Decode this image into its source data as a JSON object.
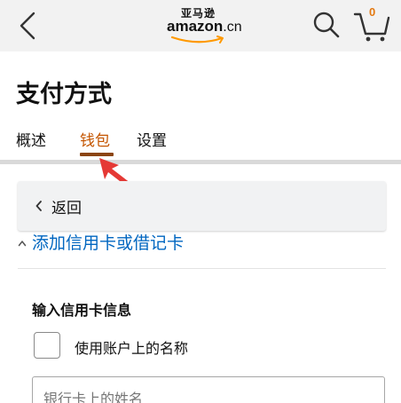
{
  "header": {
    "logo_cn": "亚马逊",
    "logo_main": "amazon",
    "logo_suffix": ".cn",
    "cart_count": "0"
  },
  "page": {
    "title": "支付方式"
  },
  "tabs": [
    {
      "label": "概述",
      "active": false
    },
    {
      "label": "钱包",
      "active": true
    },
    {
      "label": "设置",
      "active": false
    }
  ],
  "back_bar": {
    "label": "返回"
  },
  "add_card": {
    "label": "添加信用卡或借记卡"
  },
  "card_form": {
    "heading": "输入信用卡信息",
    "use_account_name_label": "使用账户上的名称",
    "name_placeholder": "银行卡上的姓名"
  },
  "colors": {
    "link": "#0066c0",
    "active_tab": "#c45500",
    "tab_underline": "#8b4513",
    "arrow": "#e53935",
    "logo_smile": "#ff9900"
  }
}
